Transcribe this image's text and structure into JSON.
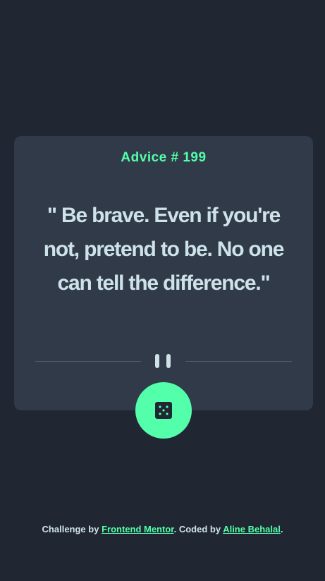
{
  "card": {
    "advice_label": "Advice # 199",
    "quote": "\" Be brave. Even if you're not, pretend to be. No one can tell the difference.\""
  },
  "divider": {
    "icon": "pause-icon"
  },
  "dice_button": {
    "icon": "dice-icon"
  },
  "footer": {
    "prefix": "Challenge by ",
    "challenge_link": "Frontend Mentor",
    "middle": ". Coded by ",
    "author_link": "Aline Behalal",
    "suffix": "."
  },
  "colors": {
    "background": "#202632",
    "card": "#313a48",
    "accent": "#53ffaa",
    "text": "#cee3e9",
    "divider": "#4f5d74"
  }
}
